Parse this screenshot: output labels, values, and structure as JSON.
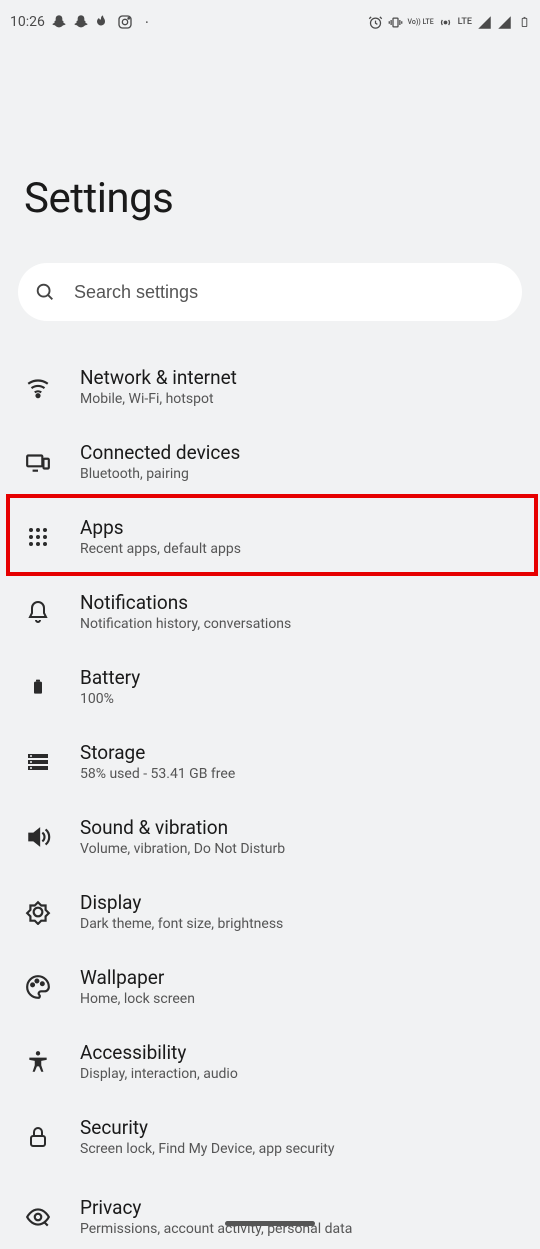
{
  "status": {
    "time": "10:26",
    "lte": "LTE",
    "volte": "Vo)) LTE"
  },
  "title": "Settings",
  "search": {
    "placeholder": "Search settings"
  },
  "items": [
    {
      "title": "Network & internet",
      "sub": "Mobile, Wi-Fi, hotspot"
    },
    {
      "title": "Connected devices",
      "sub": "Bluetooth, pairing"
    },
    {
      "title": "Apps",
      "sub": "Recent apps, default apps"
    },
    {
      "title": "Notifications",
      "sub": "Notification history, conversations"
    },
    {
      "title": "Battery",
      "sub": "100%"
    },
    {
      "title": "Storage",
      "sub": "58% used - 53.41 GB free"
    },
    {
      "title": "Sound & vibration",
      "sub": "Volume, vibration, Do Not Disturb"
    },
    {
      "title": "Display",
      "sub": "Dark theme, font size, brightness"
    },
    {
      "title": "Wallpaper",
      "sub": "Home, lock screen"
    },
    {
      "title": "Accessibility",
      "sub": "Display, interaction, audio"
    },
    {
      "title": "Security",
      "sub": "Screen lock, Find My Device, app security"
    },
    {
      "title": "Privacy",
      "sub": "Permissions, account activity, personal data"
    }
  ]
}
